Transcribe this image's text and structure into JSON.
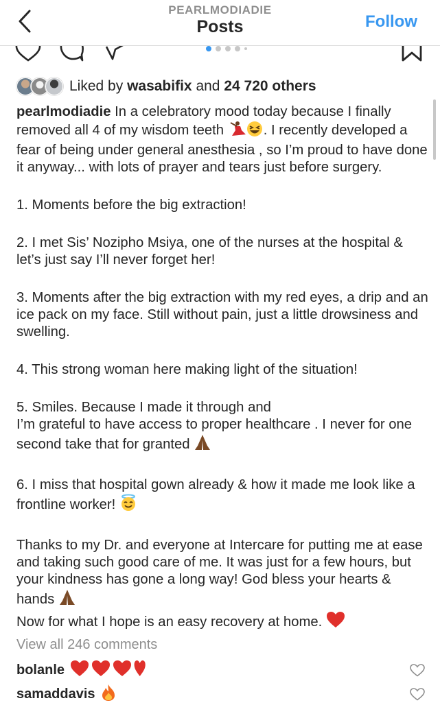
{
  "header": {
    "username": "PEARLMODIADIE",
    "title": "Posts",
    "follow_label": "Follow"
  },
  "icons": {
    "back": "chevron-left-icon",
    "like": "heart-icon",
    "comment": "comment-icon",
    "share": "share-icon",
    "save": "bookmark-icon"
  },
  "carousel": {
    "count": 5,
    "active_index": 0
  },
  "likes": {
    "prefix": "Liked by",
    "user": "wasabifix",
    "connector": "and",
    "others": "24 720 others"
  },
  "caption": {
    "username": "pearlmodiadie",
    "p1_a": "In a celebratory mood today because I finally removed all 4 of my wisdom teeth",
    "p1_b": ". I recently developed a fear of being under general anesthesia , so I’m proud to have done it anyway... with lots of prayer and tears just before surgery.",
    "p2": "1. Moments before the big extraction!",
    "p3": "2. I met Sis’ Nozipho Msiya, one of the nurses at the hospital & let’s just say I’ll never forget her!",
    "p4": "3. Moments after the big extraction with my red eyes, a drip and an ice pack on my face. Still without pain, just a little drowsiness and swelling.",
    "p5": "4. This strong woman here making light of the situation!",
    "p6_a": "5. Smiles. Because I made it through and",
    "p6_b": "I’m grateful to have access to proper healthcare . I never for one second take that for granted",
    "p7": "6. I miss that hospital gown already & how it made me look like a frontline worker!",
    "p8_a": "Thanks to my Dr. and everyone at Intercare for putting me at ease and taking such good care of me. It was just for a few hours, but your kindness has gone a long way! God bless your hearts & hands",
    "p8_b": "Now for what I hope is an easy recovery at home."
  },
  "view_all_comments": "View all 246 comments",
  "comments": [
    {
      "user": "bolanle",
      "emoji": "four red hearts"
    },
    {
      "user": "samaddavis",
      "emoji": "fire"
    }
  ],
  "colors": {
    "link_blue": "#3897f0",
    "muted": "#8e8e8e",
    "text": "#262626",
    "heart_red": "#e0302b"
  }
}
